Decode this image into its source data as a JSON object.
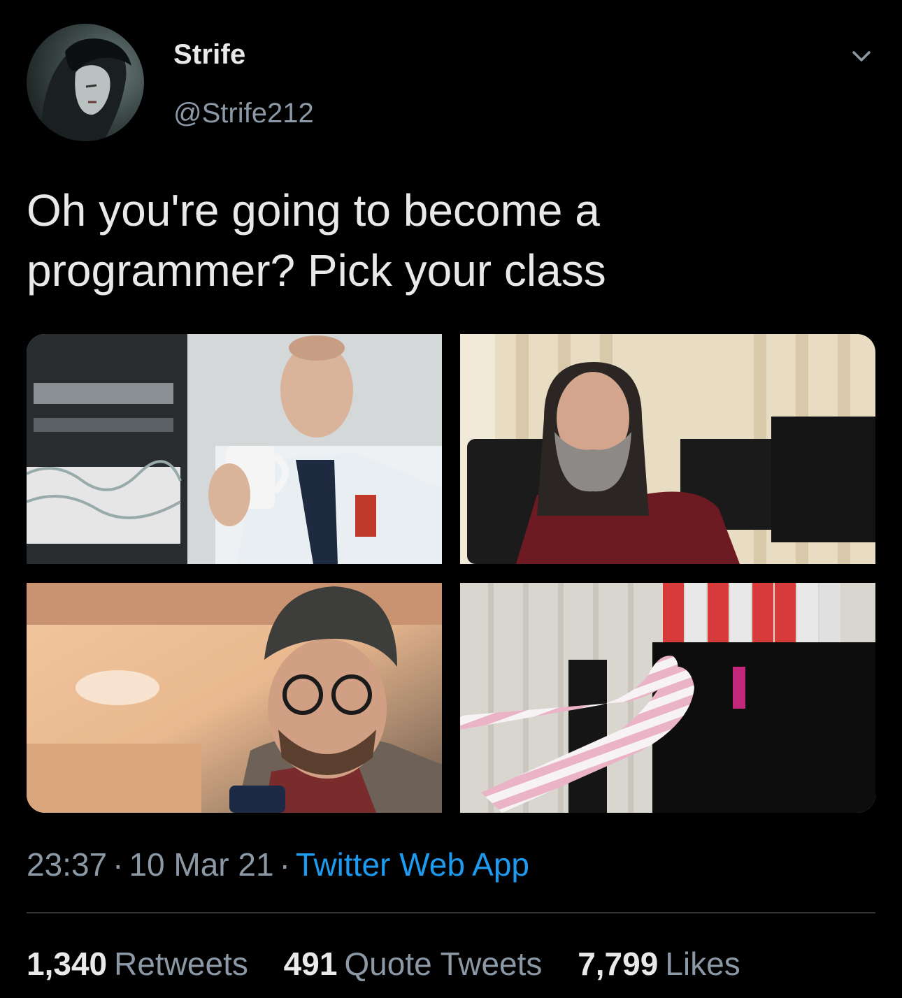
{
  "author": {
    "name": "Strife",
    "handle": "@Strife212",
    "avatar_icon": "avatar-image"
  },
  "menu_icon": "chevron-down-icon",
  "tweet": {
    "line1": "Oh you're going to become a",
    "line2": "programmer? Pick your class"
  },
  "media": [
    {
      "name": "photo-office-coffee-guy",
      "icon": "photo"
    },
    {
      "name": "photo-bearded-man",
      "icon": "photo"
    },
    {
      "name": "photo-hipster-glasses",
      "icon": "photo"
    },
    {
      "name": "photo-striped-socks-setup",
      "icon": "photo"
    }
  ],
  "meta": {
    "time": "23:37",
    "date": "10 Mar 21",
    "separator": "·",
    "source": "Twitter Web App"
  },
  "stats": {
    "retweets_count": "1,340",
    "retweets_label": "Retweets",
    "quotes_count": "491",
    "quotes_label": "Quote Tweets",
    "likes_count": "7,799",
    "likes_label": "Likes"
  },
  "colors": {
    "background": "#000000",
    "text": "#e7e9ea",
    "secondary": "#8b98a5",
    "link": "#1d9bf0",
    "divider": "#2f3336"
  }
}
